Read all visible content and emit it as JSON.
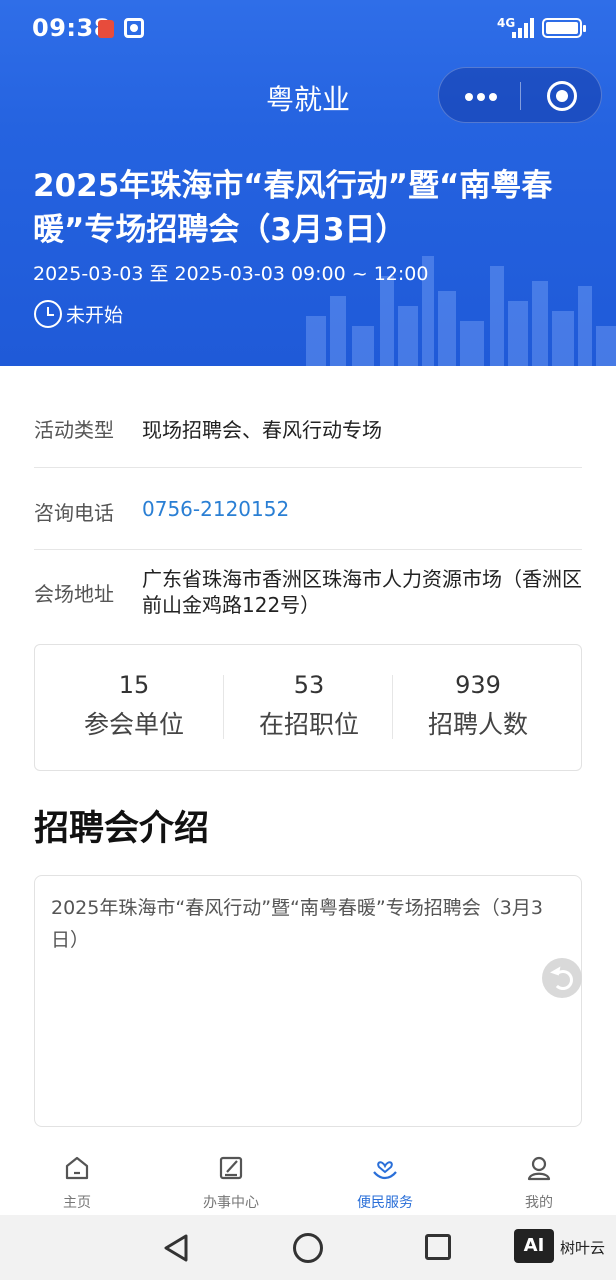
{
  "status": {
    "time": "09:38",
    "network": "4G"
  },
  "nav": {
    "title": "粤就业"
  },
  "banner": {
    "title": "2025年珠海市“春风行动”暨“南粤春暖”专场招聘会（3月3日）",
    "date": "2025-03-03 至 2025-03-03   09:00 ~ 12:00",
    "status": "未开始"
  },
  "info": [
    {
      "label": "活动类型",
      "value": "现场招聘会、春风行动专场"
    },
    {
      "label": "咨询电话",
      "value": "0756-2120152"
    },
    {
      "label": "会场地址",
      "value": "广东省珠海市香洲区珠海市人力资源市场（香洲区前山金鸡路122号）"
    }
  ],
  "stats": [
    {
      "value": "15",
      "label": "参会单位"
    },
    {
      "value": "53",
      "label": "在招职位"
    },
    {
      "value": "939",
      "label": "招聘人数"
    }
  ],
  "intro": {
    "heading": "招聘会介绍",
    "text": "2025年珠海市“春风行动”暨“南粤春暖”专场招聘会（3月3日）"
  },
  "tabs": [
    {
      "label": "主页",
      "icon": "home-icon"
    },
    {
      "label": "办事中心",
      "icon": "edit-icon"
    },
    {
      "label": "便民服务",
      "icon": "heart-hand-icon",
      "active": true
    },
    {
      "label": "我的",
      "icon": "user-icon"
    }
  ],
  "watermark": {
    "badge": "AI",
    "text": "树叶云"
  },
  "colors": {
    "primary": "#2563e0",
    "link": "#2a7fd4",
    "tab_active": "#2a6fd8"
  }
}
